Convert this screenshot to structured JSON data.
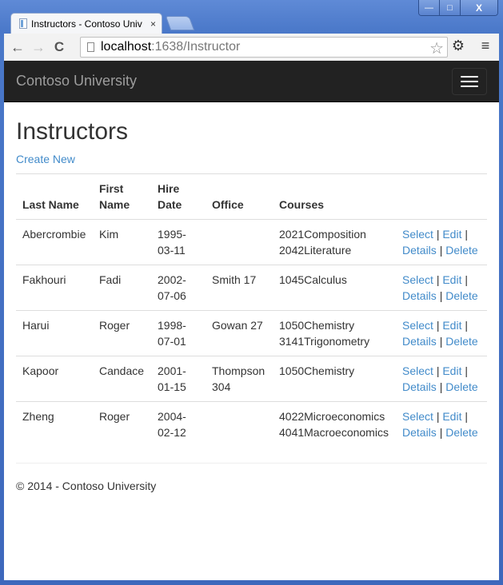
{
  "browser": {
    "tab_title": "Instructors - Contoso University",
    "tab_title_visible": "Instructors - Contoso Univ",
    "url_host": "localhost",
    "url_path": ":1638/Instructor",
    "window_controls": {
      "minimize": "—",
      "maximize": "□",
      "close": "X"
    },
    "icons": {
      "back": "←",
      "forward": "→",
      "reload": "C",
      "star": "☆",
      "settings": "⚙",
      "menu": "≡",
      "tab_close": "×"
    }
  },
  "navbar": {
    "brand": "Contoso University"
  },
  "page": {
    "title": "Instructors",
    "create_new": "Create New",
    "table": {
      "headers": [
        "Last Name",
        "First Name",
        "Hire Date",
        "Office",
        "Courses",
        ""
      ],
      "rows": [
        {
          "last_name": "Abercrombie",
          "first_name": "Kim",
          "hire_date": "1995-03-11",
          "office": "",
          "courses": [
            "2021Composition",
            "2042Literature"
          ]
        },
        {
          "last_name": "Fakhouri",
          "first_name": "Fadi",
          "hire_date": "2002-07-06",
          "office": "Smith 17",
          "courses": [
            "1045Calculus"
          ]
        },
        {
          "last_name": "Harui",
          "first_name": "Roger",
          "hire_date": "1998-07-01",
          "office": "Gowan 27",
          "courses": [
            "1050Chemistry",
            "3141Trigonometry"
          ]
        },
        {
          "last_name": "Kapoor",
          "first_name": "Candace",
          "hire_date": "2001-01-15",
          "office": "Thompson 304",
          "courses": [
            "1050Chemistry"
          ]
        },
        {
          "last_name": "Zheng",
          "first_name": "Roger",
          "hire_date": "2004-02-12",
          "office": "",
          "courses": [
            "4022Microeconomics",
            "4041Macroeconomics"
          ]
        }
      ],
      "actions": {
        "select": "Select",
        "edit": "Edit",
        "details": "Details",
        "delete": "Delete",
        "separator": "|"
      }
    },
    "footer": "© 2014 - Contoso University"
  },
  "colors": {
    "link": "#428bca",
    "navbar_bg": "#222222",
    "brand_text": "#9d9d9d"
  }
}
